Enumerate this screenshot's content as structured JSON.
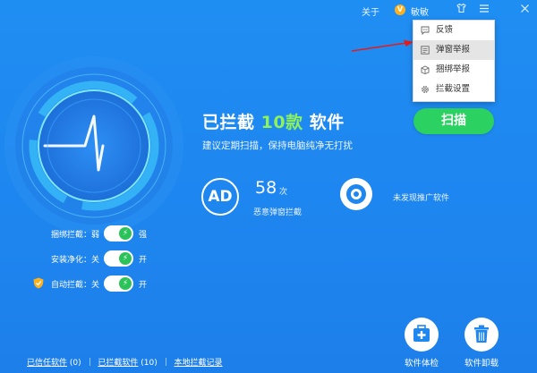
{
  "topbar": {
    "about_label": "关于",
    "avatar_letter": "V",
    "username": "敏敏",
    "skin_icon": "shirt-icon",
    "menu_icon": "hamburger-icon",
    "close_icon": "close-icon"
  },
  "dropdown": {
    "items": [
      {
        "label": "反馈",
        "icon": "speech-bubble-icon"
      },
      {
        "label": "弹窗举报",
        "icon": "popup-report-icon"
      },
      {
        "label": "捆绑举报",
        "icon": "bundle-report-icon"
      },
      {
        "label": "拦截设置",
        "icon": "gear-icon"
      }
    ]
  },
  "main": {
    "headline_prefix": "已拦截",
    "headline_highlight": "10款",
    "headline_suffix": "软件",
    "subline": "建议定期扫描，保持电脑纯净无打扰",
    "scan_button": "扫描"
  },
  "stats": {
    "ad_badge": "AD",
    "popup_count": "58",
    "popup_unit": "次",
    "popup_label": "恶意弹窗拦截",
    "promo_label": "未发现推广软件"
  },
  "toggles": [
    {
      "label": "捆绑拦截：弱",
      "value": "强",
      "knob": "⚡"
    },
    {
      "label": "安装净化：关",
      "value": "开",
      "knob": "⚡"
    },
    {
      "label": "自动拦截：关",
      "value": "开",
      "knob": "⚡"
    }
  ],
  "tools": {
    "checkup_label": "软件体检",
    "uninstall_label": "软件卸载"
  },
  "footer": {
    "trusted_label": "已信任软件",
    "trusted_count": "(0)",
    "blocked_label": "已拦截软件",
    "blocked_count": "(10)",
    "records_label": "本地拦截记录"
  },
  "colors": {
    "background": "#1e88f0",
    "accent_green": "#2bd161",
    "highlight_green": "#8df25b",
    "avatar_orange": "#ffb11b"
  }
}
